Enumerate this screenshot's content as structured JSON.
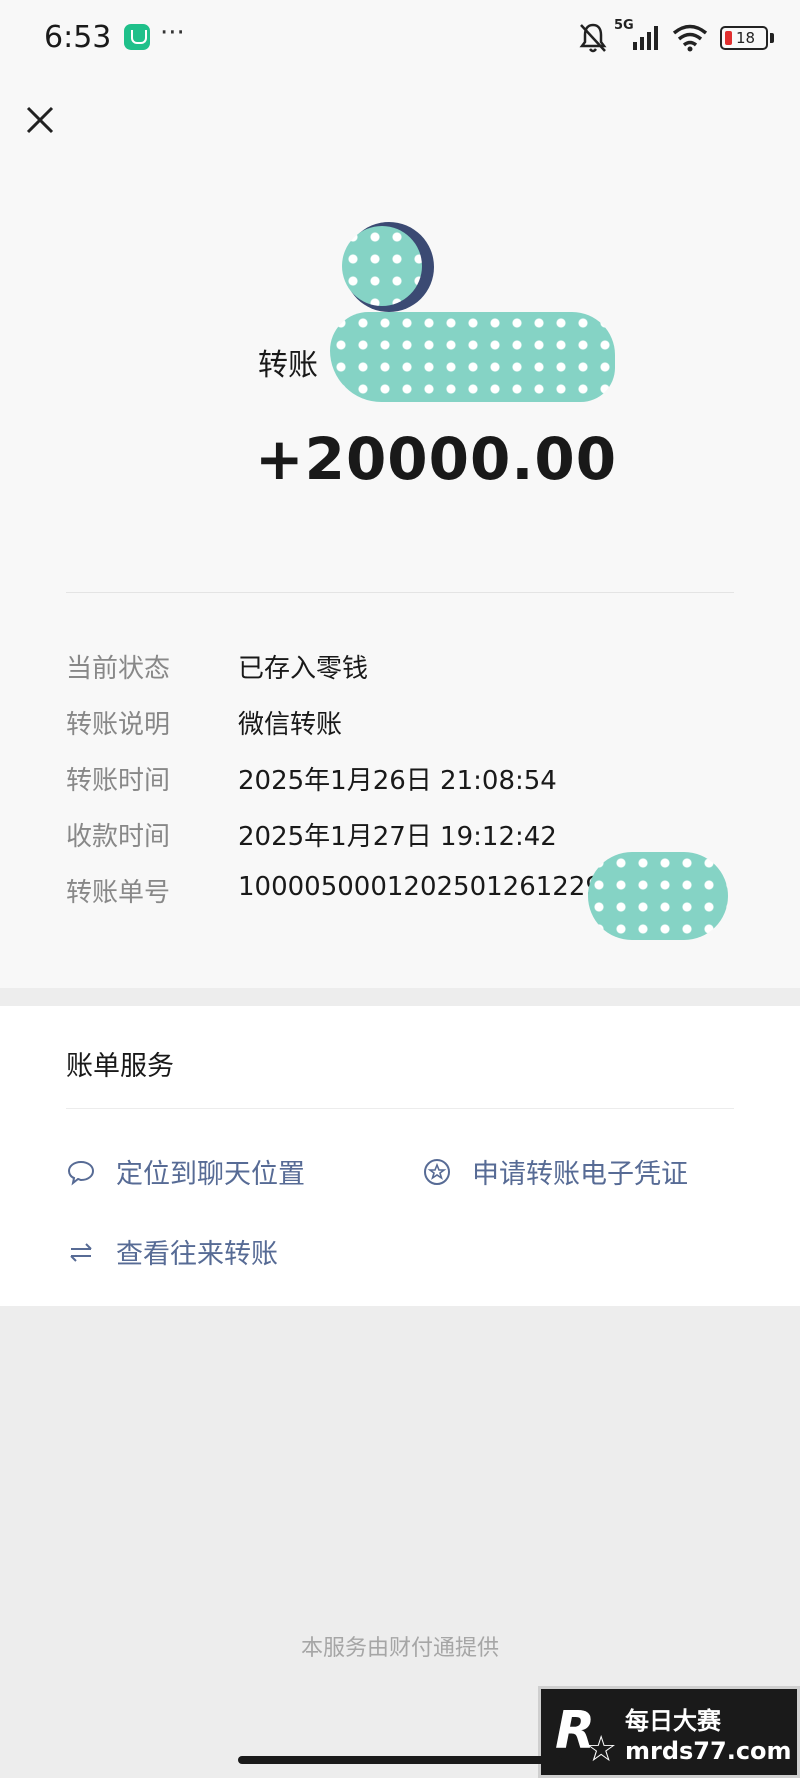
{
  "status_bar": {
    "time": "6:53",
    "more": "···",
    "network": "5G",
    "battery": "18"
  },
  "transfer": {
    "payer_prefix": "转账",
    "amount": "+20000.00"
  },
  "details": [
    {
      "label": "当前状态",
      "value": "已存入零钱"
    },
    {
      "label": "转账说明",
      "value": "微信转账"
    },
    {
      "label": "转账时间",
      "value": "2025年1月26日 21:08:54"
    },
    {
      "label": "收款时间",
      "value": "2025年1月27日 19:12:42"
    },
    {
      "label": "转账单号",
      "value": "1000050001202501261229"
    }
  ],
  "services": {
    "title": "账单服务",
    "locate_chat": "定位到聊天位置",
    "apply_voucher": "申请转账电子凭证",
    "view_transfers": "查看往来转账"
  },
  "footer": "本服务由财付通提供",
  "watermark": {
    "logo": "R",
    "title": "每日大赛",
    "url": "mrds77.com"
  },
  "colors": {
    "link": "#576b95",
    "label_gray": "#888888",
    "mask_teal": "#85d3c5"
  }
}
